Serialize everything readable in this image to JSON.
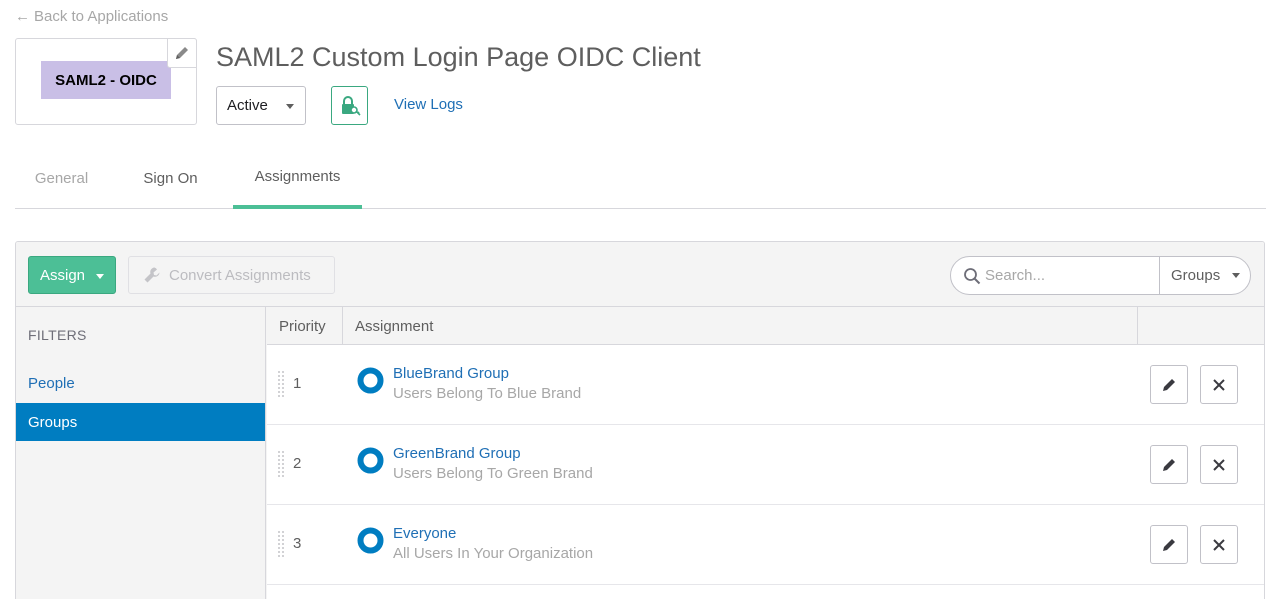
{
  "back_link": {
    "arrow": "←",
    "label": "Back to Applications"
  },
  "app": {
    "logo_text": "SAML2 - OIDC",
    "title": "SAML2 Custom Login Page OIDC Client",
    "status": "Active",
    "view_logs": "View Logs"
  },
  "tabs": [
    {
      "label": "General"
    },
    {
      "label": "Sign On"
    },
    {
      "label": "Assignments",
      "active": true
    }
  ],
  "toolbar": {
    "assign_label": "Assign",
    "convert_label": "Convert Assignments",
    "search_placeholder": "Search...",
    "search_filter": "Groups"
  },
  "filters": {
    "heading": "FILTERS",
    "items": [
      {
        "label": "People",
        "selected": false
      },
      {
        "label": "Groups",
        "selected": true
      }
    ]
  },
  "table": {
    "columns": [
      "Priority",
      "Assignment"
    ],
    "rows": [
      {
        "priority": "1",
        "name": "BlueBrand Group",
        "description": "Users Belong To Blue Brand"
      },
      {
        "priority": "2",
        "name": "GreenBrand Group",
        "description": "Users Belong To Green Brand"
      },
      {
        "priority": "3",
        "name": "Everyone",
        "description": "All Users In Your Organization"
      }
    ]
  },
  "icons": {
    "logo_edit": "pencil-icon",
    "lock": "lock-key-icon",
    "convert": "wrench-icon",
    "search": "search-icon",
    "group": "group-ring-icon",
    "row_edit": "pencil-icon",
    "row_remove": "close-icon"
  },
  "colors": {
    "accent_green": "#4cbf96",
    "link_blue": "#1f6fb5",
    "selected_blue": "#007dc1",
    "logo_tile": "#c9bfe6"
  }
}
